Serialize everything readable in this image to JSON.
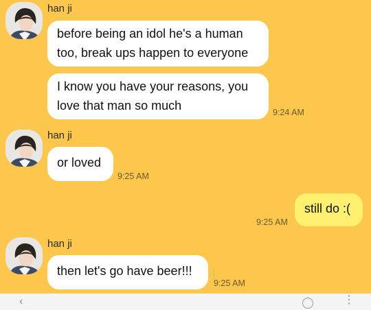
{
  "contact": {
    "name": "han ji"
  },
  "messages": [
    {
      "id": "m1",
      "from": "han ji",
      "text_lines": [
        "before being an idol he's a human",
        "too, break ups happen to everyone"
      ]
    },
    {
      "id": "m2",
      "from": "han ji",
      "text_lines": [
        "I know you have your reasons, you",
        "love that man so much"
      ],
      "time": "9:24 AM"
    },
    {
      "id": "m3",
      "from": "han ji",
      "text": "or loved",
      "time": "9:25 AM"
    },
    {
      "id": "m4",
      "from": "me",
      "text": "still do :(",
      "time": "9:25 AM"
    },
    {
      "id": "m5",
      "from": "han ji",
      "text": "then let's go have beer!!!",
      "time": "9:25 AM"
    }
  ],
  "colors": {
    "background": "#fcc74c",
    "incoming_bubble": "#ffffff",
    "outgoing_bubble": "#fff06f",
    "timestamp": "#6b5a2e"
  },
  "icons": [
    "avatar",
    "back-arrow-icon",
    "emoji-icon",
    "more-icon"
  ]
}
